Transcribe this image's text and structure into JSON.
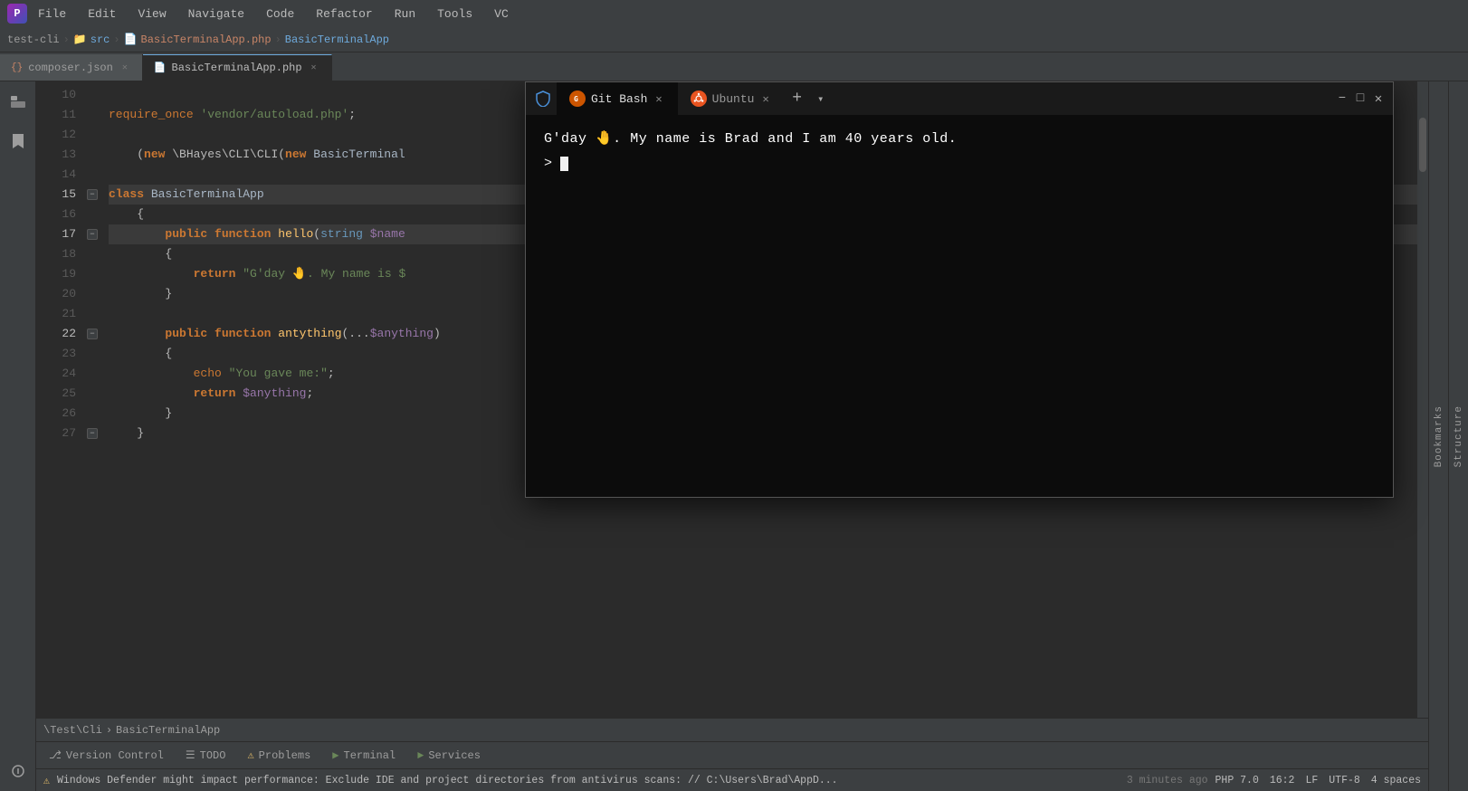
{
  "app": {
    "title": "PhpStorm",
    "logo_char": "🧠"
  },
  "menu": {
    "items": [
      "File",
      "Edit",
      "View",
      "Navigate",
      "Code",
      "Refactor",
      "Run",
      "Tools",
      "VC"
    ]
  },
  "breadcrumb": {
    "project": "test-cli",
    "sep1": "›",
    "folder": "src",
    "sep2": "›",
    "file_icon": "BasicTerminalApp.php",
    "sep3": "›",
    "class": "BasicTerminalApp"
  },
  "tabs": [
    {
      "id": "composer",
      "label": "composer.json",
      "active": false,
      "icon": "📄"
    },
    {
      "id": "basicapp",
      "label": "BasicTerminalApp.php",
      "active": true,
      "icon": "📄"
    }
  ],
  "code": {
    "lines": [
      {
        "num": 10,
        "content": ""
      },
      {
        "num": 11,
        "raw": "    require_once 'vendor/autoload.php';",
        "parts": [
          {
            "text": "    ",
            "cls": ""
          },
          {
            "text": "require_once",
            "cls": "req"
          },
          {
            "text": " ",
            "cls": ""
          },
          {
            "text": "'vendor/autoload.php'",
            "cls": "str"
          },
          {
            "text": ";",
            "cls": "punct"
          }
        ]
      },
      {
        "num": 12,
        "content": ""
      },
      {
        "num": 13,
        "raw": "    (new \\BHayes\\CLI\\CLI(new BasicTerminal",
        "parts": [
          {
            "text": "    ",
            "cls": ""
          },
          {
            "text": "(",
            "cls": "punct"
          },
          {
            "text": "new",
            "cls": "kw"
          },
          {
            "text": " \\BHayes\\CLI\\CLI(",
            "cls": ""
          },
          {
            "text": "new",
            "cls": "kw"
          },
          {
            "text": " BasicTerminal",
            "cls": "cls"
          }
        ]
      },
      {
        "num": 14,
        "content": ""
      },
      {
        "num": 15,
        "raw": "class BasicTerminalApp",
        "parts": [
          {
            "text": "class",
            "cls": "kw"
          },
          {
            "text": " BasicTerminalApp",
            "cls": "cls"
          }
        ],
        "fold": true
      },
      {
        "num": 16,
        "raw": "{",
        "parts": [
          {
            "text": "    {",
            "cls": "punct"
          }
        ],
        "fold_open": true
      },
      {
        "num": 17,
        "raw": "    public function hello(string $name",
        "parts": [
          {
            "text": "        ",
            "cls": ""
          },
          {
            "text": "public",
            "cls": "kw"
          },
          {
            "text": " ",
            "cls": ""
          },
          {
            "text": "function",
            "cls": "kw"
          },
          {
            "text": " ",
            "cls": ""
          },
          {
            "text": "hello",
            "cls": "fn"
          },
          {
            "text": "(",
            "cls": "punct"
          },
          {
            "text": "string",
            "cls": "type"
          },
          {
            "text": " ",
            "cls": ""
          },
          {
            "text": "$name",
            "cls": "var"
          }
        ],
        "fold": true
      },
      {
        "num": 18,
        "raw": "    {",
        "parts": [
          {
            "text": "        {",
            "cls": "punct"
          }
        ]
      },
      {
        "num": 19,
        "raw": "        return \"G'day 🤚. My name is $",
        "parts": [
          {
            "text": "            ",
            "cls": ""
          },
          {
            "text": "return",
            "cls": "kw"
          },
          {
            "text": " ",
            "cls": ""
          },
          {
            "text": "\"G'day 🤚. My name is $",
            "cls": "str"
          }
        ]
      },
      {
        "num": 20,
        "raw": "    }",
        "parts": [
          {
            "text": "        }",
            "cls": "punct"
          }
        ]
      },
      {
        "num": 21,
        "content": ""
      },
      {
        "num": 22,
        "raw": "    public function antything(...$anything)",
        "parts": [
          {
            "text": "        ",
            "cls": ""
          },
          {
            "text": "public",
            "cls": "kw"
          },
          {
            "text": " ",
            "cls": ""
          },
          {
            "text": "function",
            "cls": "kw"
          },
          {
            "text": " ",
            "cls": ""
          },
          {
            "text": "antything",
            "cls": "fn"
          },
          {
            "text": "(",
            "cls": "punct"
          },
          {
            "text": "...",
            "cls": ""
          },
          {
            "text": "$anything",
            "cls": "var"
          },
          {
            "text": ")",
            "cls": "punct"
          }
        ],
        "fold": true
      },
      {
        "num": 23,
        "raw": "    {",
        "parts": [
          {
            "text": "        {",
            "cls": "punct"
          }
        ]
      },
      {
        "num": 24,
        "raw": "        echo \"You gave me:\";",
        "parts": [
          {
            "text": "            ",
            "cls": ""
          },
          {
            "text": "echo",
            "cls": "echo-kw"
          },
          {
            "text": " ",
            "cls": ""
          },
          {
            "text": "\"You gave me:\"",
            "cls": "str"
          },
          {
            "text": ";",
            "cls": "punct"
          }
        ]
      },
      {
        "num": 25,
        "raw": "        return $anything;",
        "parts": [
          {
            "text": "            ",
            "cls": ""
          },
          {
            "text": "return",
            "cls": "kw"
          },
          {
            "text": " ",
            "cls": ""
          },
          {
            "text": "$anything",
            "cls": "var"
          },
          {
            "text": ";",
            "cls": "punct"
          }
        ]
      },
      {
        "num": 26,
        "raw": "    }",
        "parts": [
          {
            "text": "        }",
            "cls": "punct"
          }
        ]
      },
      {
        "num": 27,
        "raw": "}",
        "parts": [
          {
            "text": "    }",
            "cls": "punct"
          }
        ],
        "fold_close": true
      }
    ]
  },
  "bottom_panel": {
    "tabs": [
      {
        "id": "version-control",
        "label": "Version Control",
        "icon": "⎇",
        "active": false
      },
      {
        "id": "todo",
        "label": "TODO",
        "icon": "☰",
        "active": false
      },
      {
        "id": "problems",
        "label": "Problems",
        "icon": "⚠",
        "active": false
      },
      {
        "id": "terminal",
        "label": "Terminal",
        "icon": "▶",
        "active": false
      },
      {
        "id": "services",
        "label": "Services",
        "icon": "►",
        "active": false
      }
    ]
  },
  "path_bar": {
    "parts": [
      "\\Test\\Cli",
      "›",
      "BasicTerminalApp"
    ]
  },
  "status_bar": {
    "warning": "Windows Defender might impact performance: Exclude IDE and project directories from antivirus scans: // C:\\Users\\Brad\\AppD...",
    "warning_time": "3 minutes ago",
    "php_version": "PHP 7.0",
    "position": "16:2",
    "line_ending": "LF",
    "encoding": "UTF-8",
    "indent": "4 spaces"
  },
  "terminal": {
    "title": "Terminal",
    "tabs": [
      {
        "id": "git-bash",
        "label": "Git Bash",
        "active": true
      },
      {
        "id": "ubuntu",
        "label": "Ubuntu",
        "active": false
      }
    ],
    "output": "G'day 🤚. My name is Brad and I am 40 years old.",
    "prompt": ">",
    "shield_icon": "🛡"
  },
  "sidebar": {
    "icons": [
      {
        "id": "project",
        "label": "Project",
        "char": "📁"
      },
      {
        "id": "bookmarks",
        "label": "Bookmarks",
        "char": "🔖"
      },
      {
        "id": "structure",
        "label": "Structure",
        "char": "⊞"
      }
    ]
  },
  "bookmarks_label": "Bookmarks",
  "structure_label": "Structure"
}
